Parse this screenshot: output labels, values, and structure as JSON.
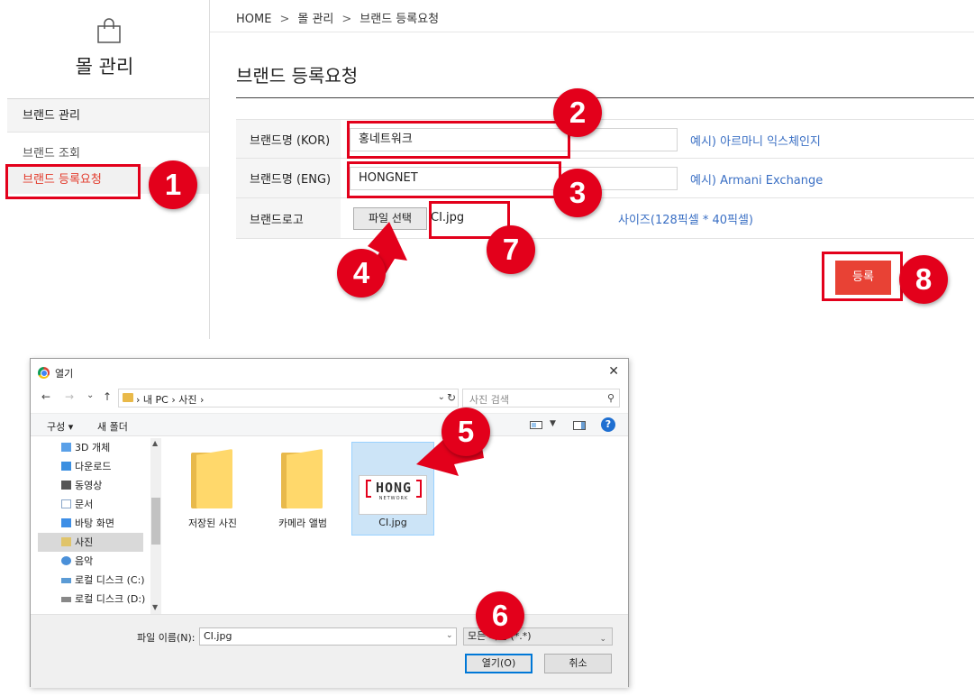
{
  "sidebar": {
    "title": "몰 관리",
    "group_label": "브랜드 관리",
    "links": [
      "브랜드 조회",
      "브랜드 등록요청"
    ],
    "active_color": "#e23a2b"
  },
  "breadcrumb": {
    "home": "HOME",
    "sep": ">",
    "level1": "몰 관리",
    "level2": "브랜드 등록요청"
  },
  "page": {
    "title": "브랜드 등록요청"
  },
  "form": {
    "kor_label": "브랜드명 (KOR)",
    "kor_value": "홍네트워크",
    "kor_hint": "예시) 아르마니 익스체인지",
    "eng_label": "브랜드명 (ENG)",
    "eng_value": "HONGNET",
    "eng_hint": "예시) Armani Exchange",
    "logo_label": "브랜드로고",
    "file_button": "파일 선택",
    "file_name": "CI.jpg",
    "logo_hint": "사이즈(128픽셀 * 40픽셀)",
    "submit": "등록"
  },
  "annotations": {
    "color": "#e3001b",
    "badges": [
      "1",
      "2",
      "3",
      "4",
      "5",
      "6",
      "7",
      "8"
    ]
  },
  "dialog": {
    "title": "열기",
    "close": "✕",
    "nav": {
      "back": "←",
      "forward": "→",
      "recent": "⌄",
      "up": "↑"
    },
    "path": "› 내 PC › 사진 ›",
    "refresh": "↻",
    "search_placeholder": "사진 검색",
    "toolbar": {
      "organize": "구성 ▾",
      "new_folder": "새 폴더",
      "help": "?"
    },
    "nav_items": [
      {
        "label": "3D 개체",
        "icon_color": "#5aa0e8"
      },
      {
        "label": "다운로드",
        "icon_color": "#3b8fe0"
      },
      {
        "label": "동영상",
        "icon_color": "#555555"
      },
      {
        "label": "문서",
        "icon_color": "#8aa7c9"
      },
      {
        "label": "바탕 화면",
        "icon_color": "#3d8ee6"
      },
      {
        "label": "사진",
        "icon_color": "#e0c46a"
      },
      {
        "label": "음악",
        "icon_color": "#4a90d9"
      },
      {
        "label": "로컬 디스크 (C:)",
        "icon_color": "#5b9bd5"
      },
      {
        "label": "로컬 디스크 (D:)",
        "icon_color": "#888888"
      }
    ],
    "files": [
      {
        "label": "저장된 사진",
        "type": "folder"
      },
      {
        "label": "카메라 앨범",
        "type": "folder"
      },
      {
        "label": "CI.jpg",
        "type": "image"
      }
    ],
    "thumbnail_logo": {
      "main": "HONG",
      "sub": "NETWORK"
    },
    "filename_label": "파일 이름(N):",
    "filename_value": "CI.jpg",
    "filetype_value": "모든 파일 (*.*)",
    "open_button": "열기(O)",
    "cancel_button": "취소"
  }
}
